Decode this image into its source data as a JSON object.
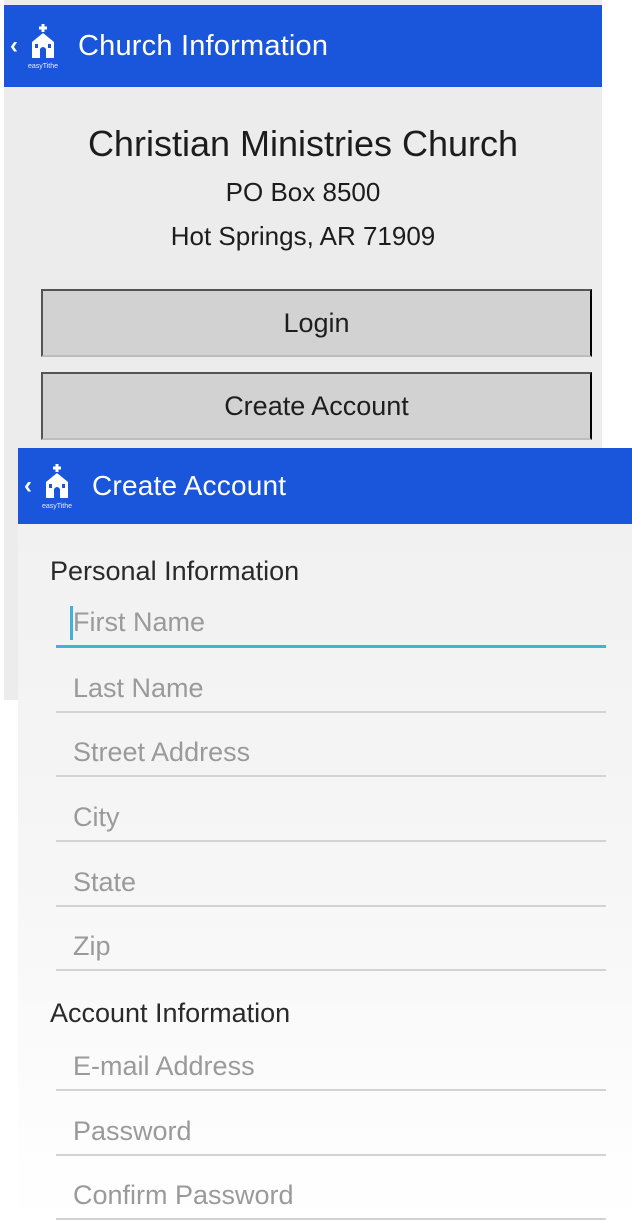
{
  "church_screen": {
    "title": "Church Information",
    "logo_text": "easyTithe",
    "church": {
      "name": "Christian Ministries Church",
      "address_line1": "PO Box 8500",
      "address_line2": "Hot Springs, AR   71909"
    },
    "buttons": {
      "login": "Login",
      "create_account": "Create Account"
    }
  },
  "create_screen": {
    "title": "Create Account",
    "logo_text": "easyTithe",
    "personal_section": "Personal Information",
    "account_section": "Account Information",
    "fields": {
      "first_name": "First Name",
      "last_name": "Last Name",
      "street": "Street Address",
      "city": "City",
      "state": "State",
      "zip": "Zip",
      "email": "E-mail Address",
      "password": "Password",
      "confirm_password": "Confirm Password"
    }
  },
  "colors": {
    "appbar": "#1a56db",
    "button": "#d2d2d2",
    "focus_underline": "#3fb3d3"
  }
}
